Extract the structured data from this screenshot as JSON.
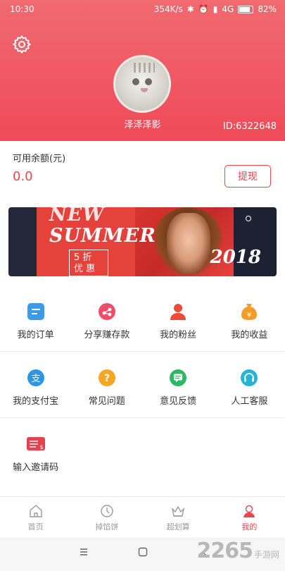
{
  "status_bar": {
    "time": "10:30",
    "speed": "354K/s",
    "network": "4G",
    "battery": "82%",
    "battery_level": 0.82
  },
  "profile": {
    "username": "泽泽泽影",
    "user_id": "ID:6322648"
  },
  "balance": {
    "label": "可用余额(元)",
    "value": "0.0",
    "withdraw_label": "提现"
  },
  "banner": {
    "title_line1": "NEW",
    "title_line2": "SUMMER",
    "sale_line1": "5 折",
    "sale_line2": "优 惠",
    "year": "2018"
  },
  "menu": {
    "row1": [
      {
        "label": "我的订单",
        "icon": "order-icon",
        "color": "#3a9be8"
      },
      {
        "label": "分享赚存款",
        "icon": "share-icon",
        "color": "#ee4e6a"
      },
      {
        "label": "我的粉丝",
        "icon": "fans-icon",
        "color": "#ee4a3a"
      },
      {
        "label": "我的收益",
        "icon": "income-icon",
        "color": "#f29c2a"
      }
    ],
    "row2": [
      {
        "label": "我的支付宝",
        "icon": "alipay-icon",
        "color": "#2a96e4"
      },
      {
        "label": "常见问题",
        "icon": "question-icon",
        "color": "#f5a623"
      },
      {
        "label": "意见反馈",
        "icon": "feedback-icon",
        "color": "#2db866"
      },
      {
        "label": "人工客服",
        "icon": "headset-icon",
        "color": "#27b3d8"
      }
    ],
    "row3": [
      {
        "label": "输入邀请码",
        "icon": "invite-code-icon",
        "color": "#e4424c"
      }
    ]
  },
  "tabbar": {
    "tabs": [
      {
        "label": "首页",
        "icon": "home-icon"
      },
      {
        "label": "掉馅饼",
        "icon": "pie-icon"
      },
      {
        "label": "超划算",
        "icon": "crown-icon"
      },
      {
        "label": "我的",
        "icon": "profile-icon"
      }
    ],
    "active_index": 3
  },
  "watermark": {
    "brand": "2265",
    "suffix": "手游网"
  },
  "colors": {
    "accent": "#e8454f",
    "hero_top": "#f06a6f",
    "hero_bottom": "#ef4a58"
  }
}
